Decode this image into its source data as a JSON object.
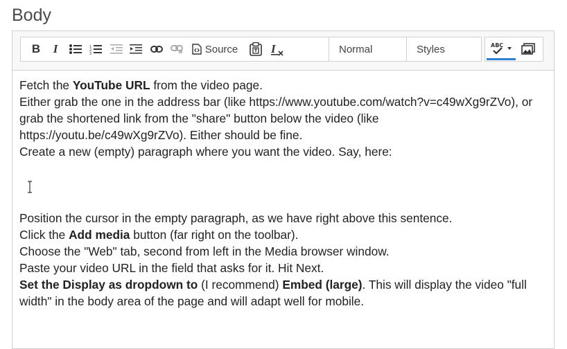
{
  "field": {
    "label": "Body"
  },
  "toolbar": {
    "source_label": "Source",
    "format_select": "Normal",
    "styles_select": "Styles",
    "buttons": [
      "bold-button",
      "italic-button",
      "bulleted-list-button",
      "numbered-list-button",
      "outdent-button",
      "indent-button",
      "link-button",
      "unlink-button",
      "source-button",
      "paste-from-word-button",
      "remove-format-button",
      "spellcheck-button",
      "add-media-button"
    ]
  },
  "content": {
    "p1_a": "Fetch the ",
    "p1_b": "YouTube URL",
    "p1_c": " from the video page.",
    "p2": "Either grab the one in the address bar (like https://www.youtube.com/watch?v=c49wXg9rZVo), or grab the shortened link from the \"share\" button below the video (like https://youtu.be/c49wXg9rZVo). Either should be fine.",
    "p3": "Create a new (empty) paragraph where you want the video. Say, here:",
    "p4": "Position the cursor in the empty paragraph, as we have right above this sentence.",
    "p5_a": "Click the ",
    "p5_b": "Add media",
    "p5_c": " button (far right on the toolbar).",
    "p6": "Choose the \"Web\" tab, second from left in the Media browser window.",
    "p7": "Paste your video URL in the field that asks for it. Hit Next.",
    "p8_a": "Set the Display as dropdown to",
    "p8_b": " (I recommend) ",
    "p8_c": "Embed (large)",
    "p8_d": ". This will display the video \"full width\" in the body area of the page and will adapt well for mobile."
  }
}
